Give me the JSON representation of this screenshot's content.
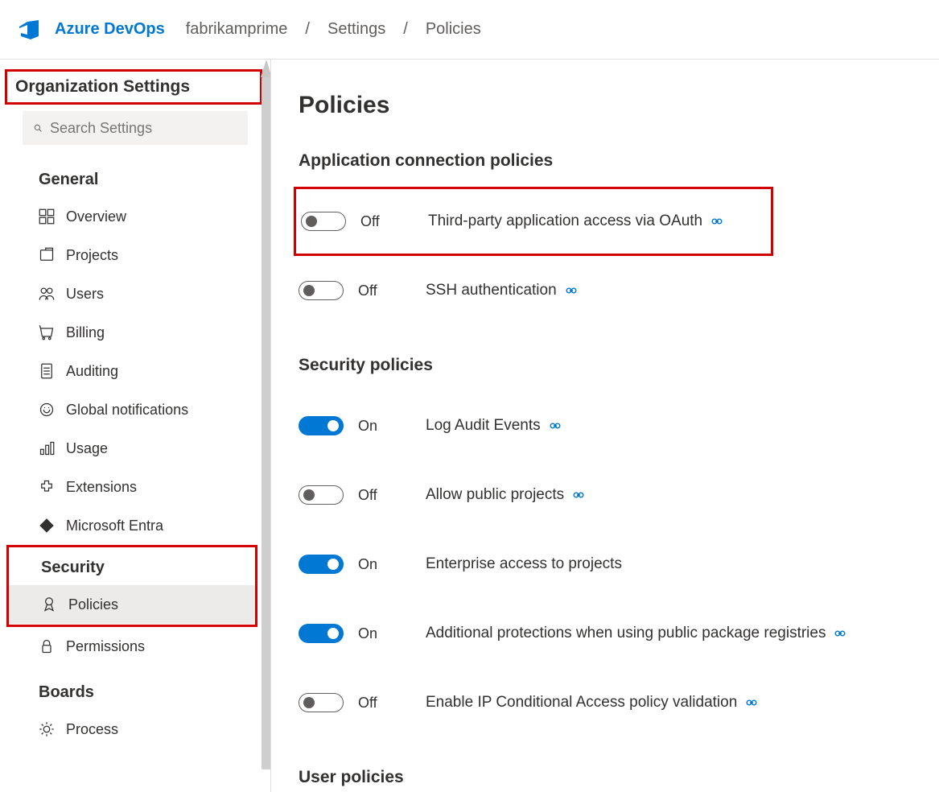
{
  "brand": "Azure DevOps",
  "breadcrumb": {
    "org": "fabrikamprime",
    "settings": "Settings",
    "current": "Policies"
  },
  "sidebar": {
    "title": "Organization Settings",
    "search_placeholder": "Search Settings",
    "groups": [
      {
        "label": "General",
        "items": [
          {
            "icon": "overview-icon",
            "label": "Overview"
          },
          {
            "icon": "projects-icon",
            "label": "Projects"
          },
          {
            "icon": "users-icon",
            "label": "Users"
          },
          {
            "icon": "billing-icon",
            "label": "Billing"
          },
          {
            "icon": "auditing-icon",
            "label": "Auditing"
          },
          {
            "icon": "notifications-icon",
            "label": "Global notifications"
          },
          {
            "icon": "usage-icon",
            "label": "Usage"
          },
          {
            "icon": "extensions-icon",
            "label": "Extensions"
          },
          {
            "icon": "entra-icon",
            "label": "Microsoft Entra"
          }
        ]
      },
      {
        "label": "Security",
        "items": [
          {
            "icon": "policies-icon",
            "label": "Policies",
            "active": true
          },
          {
            "icon": "permissions-icon",
            "label": "Permissions"
          }
        ]
      },
      {
        "label": "Boards",
        "items": [
          {
            "icon": "process-icon",
            "label": "Process"
          }
        ]
      }
    ]
  },
  "main": {
    "title": "Policies",
    "sections": [
      {
        "heading": "Application connection policies",
        "policies": [
          {
            "on": false,
            "state": "Off",
            "label": "Third-party application access via OAuth",
            "link": true,
            "boxed": true
          },
          {
            "on": false,
            "state": "Off",
            "label": "SSH authentication",
            "link": true,
            "boxed": false
          }
        ]
      },
      {
        "heading": "Security policies",
        "policies": [
          {
            "on": true,
            "state": "On",
            "label": "Log Audit Events",
            "link": true,
            "boxed": false
          },
          {
            "on": false,
            "state": "Off",
            "label": "Allow public projects",
            "link": true,
            "boxed": false
          },
          {
            "on": true,
            "state": "On",
            "label": "Enterprise access to projects",
            "link": false,
            "boxed": false
          },
          {
            "on": true,
            "state": "On",
            "label": "Additional protections when using public package registries",
            "link": true,
            "boxed": false
          },
          {
            "on": false,
            "state": "Off",
            "label": "Enable IP Conditional Access policy validation",
            "link": true,
            "boxed": false
          }
        ]
      },
      {
        "heading": "User policies",
        "policies": []
      }
    ]
  }
}
